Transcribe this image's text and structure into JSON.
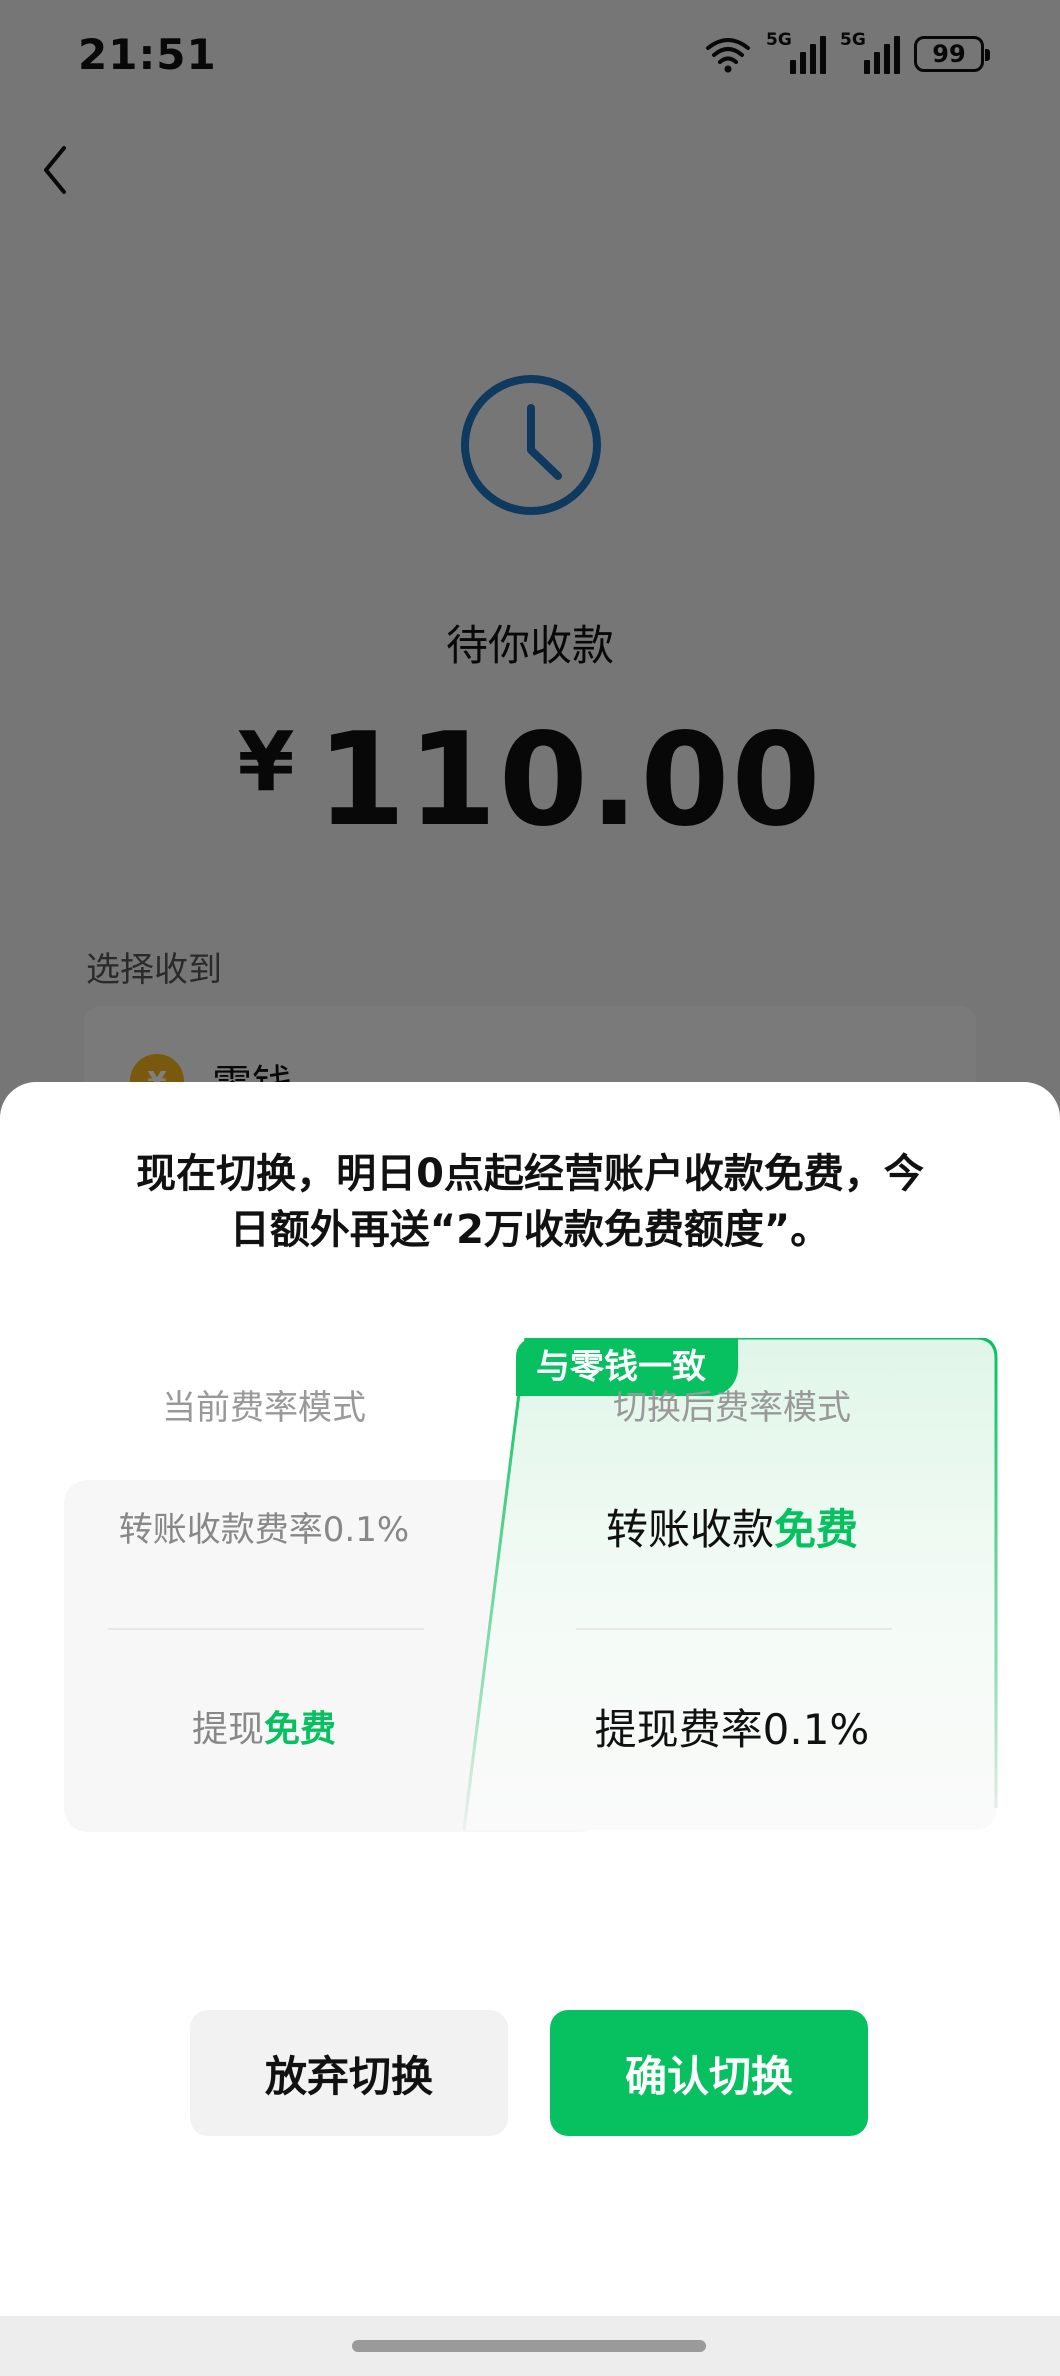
{
  "status_bar": {
    "time": "21:51",
    "signal1_label": "5G",
    "signal2_label": "5G",
    "battery": "99"
  },
  "page": {
    "pending_title": "待你收款",
    "currency_symbol": "¥",
    "amount": "110.00",
    "select_label": "选择收到",
    "option_label": "零钱",
    "option_coin": "¥"
  },
  "sheet": {
    "message_line1": "现在切换，明日0点起经营账户收款免费，今",
    "message_line2": "日额外再送“2万收款免费额度”。",
    "tag": "与零钱一致",
    "current": {
      "heading": "当前费率模式",
      "row1": "转账收款费率0.1%",
      "row2_prefix": "提现",
      "row2_highlight": "免费"
    },
    "after": {
      "heading": "切换后费率模式",
      "row1_prefix": "转账收款",
      "row1_highlight": "免费",
      "row2": "提现费率0.1%"
    },
    "cancel_label": "放弃切换",
    "confirm_label": "确认切换"
  },
  "colors": {
    "accent_green": "#07c160",
    "pending_clock": "#1a74bd",
    "coin": "#f3b31d"
  },
  "icons": [
    "back-arrow-icon",
    "clock-icon",
    "wifi-icon",
    "signal-icon",
    "battery-icon",
    "coin-icon"
  ]
}
